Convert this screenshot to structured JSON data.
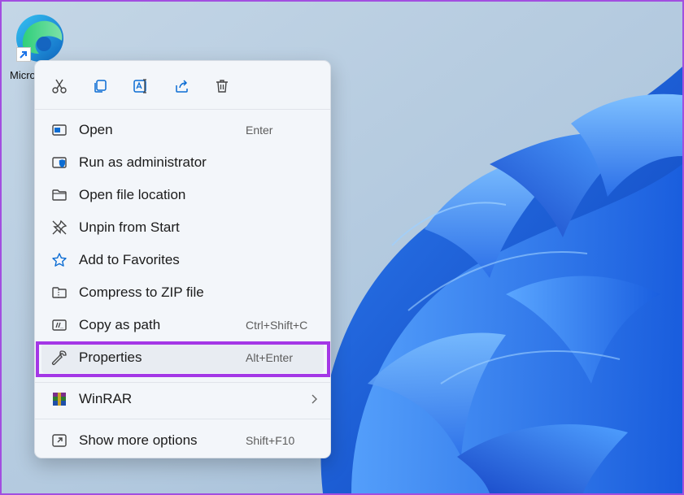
{
  "desktop": {
    "icon_label": "Microsoft Edge"
  },
  "quick_actions": [
    {
      "name": "cut"
    },
    {
      "name": "copy"
    },
    {
      "name": "rename"
    },
    {
      "name": "share"
    },
    {
      "name": "delete"
    }
  ],
  "menu": {
    "items": [
      {
        "label": "Open",
        "shortcut": "Enter",
        "icon": "open-window-icon"
      },
      {
        "label": "Run as administrator",
        "shortcut": "",
        "icon": "shield-icon"
      },
      {
        "label": "Open file location",
        "shortcut": "",
        "icon": "folder-icon"
      },
      {
        "label": "Unpin from Start",
        "shortcut": "",
        "icon": "unpin-icon"
      },
      {
        "label": "Add to Favorites",
        "shortcut": "",
        "icon": "star-icon"
      },
      {
        "label": "Compress to ZIP file",
        "shortcut": "",
        "icon": "zip-folder-icon"
      },
      {
        "label": "Copy as path",
        "shortcut": "Ctrl+Shift+C",
        "icon": "copy-path-icon"
      },
      {
        "label": "Properties",
        "shortcut": "Alt+Enter",
        "icon": "wrench-icon"
      },
      {
        "label": "WinRAR",
        "shortcut": "",
        "icon": "winrar-icon"
      },
      {
        "label": "Show more options",
        "shortcut": "Shift+F10",
        "icon": "show-more-icon"
      }
    ]
  },
  "colors": {
    "highlight_border": "#a437e6",
    "accent_blue": "#0078d4"
  }
}
